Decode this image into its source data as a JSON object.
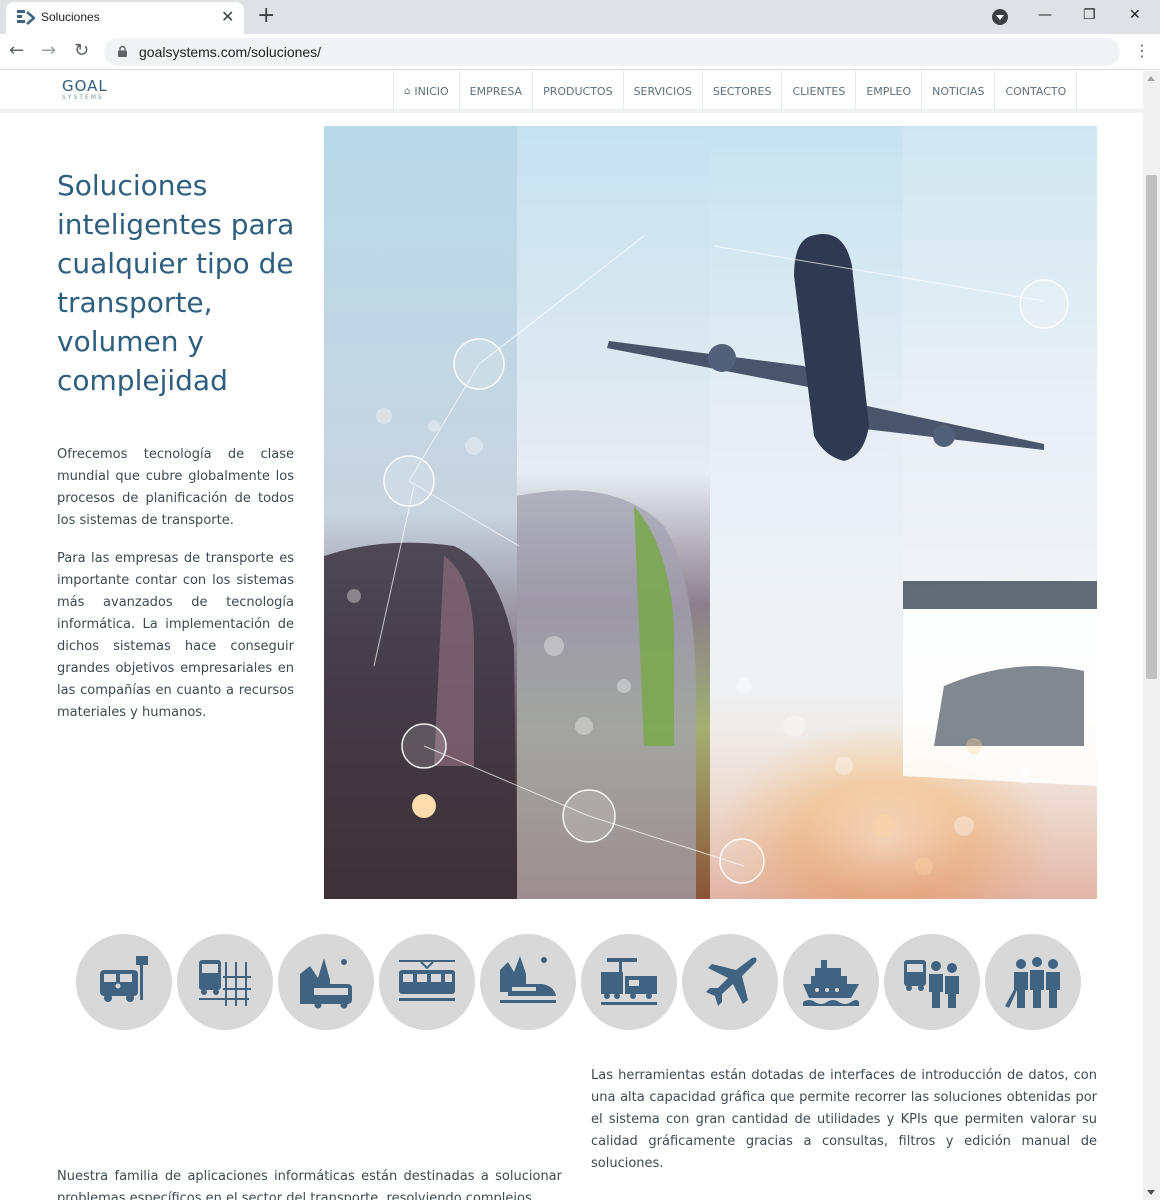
{
  "browser": {
    "tab_title": "Soluciones",
    "tab_close": "✕",
    "new_tab": "+",
    "url": "goalsystems.com/soluciones/",
    "back": "←",
    "forward": "→",
    "reload": "↻",
    "menu": "⋮",
    "minimize": "—",
    "maximize": "❐",
    "close": "✕"
  },
  "site": {
    "logo_main": "GOAL",
    "logo_sub": "SYSTEMS",
    "nav": [
      {
        "label": "INICIO",
        "icon": "home-icon"
      },
      {
        "label": "EMPRESA"
      },
      {
        "label": "PRODUCTOS"
      },
      {
        "label": "SERVICIOS"
      },
      {
        "label": "SECTORES"
      },
      {
        "label": "CLIENTES"
      },
      {
        "label": "EMPLEO"
      },
      {
        "label": "NOTICIAS"
      },
      {
        "label": "CONTACTO"
      }
    ],
    "home_glyph": "⌂"
  },
  "hero": {
    "title": "Soluciones inteligentes para cualquier tipo de transporte, volumen y complejidad",
    "paragraphs": [
      "Ofrecemos tecnología de clase mundial que cubre globalmente los procesos de planificación de todos los sistemas de transporte.",
      "Para las empresas de transporte es importante contar con los sistemas más avanzados de tecnología informática. La implementación de dichos sistemas hace conseguir grandes objetivos empresariales en las compañías en cuanto a recursos materiales y humanos."
    ]
  },
  "sectors": [
    {
      "icon": "bus-stop-icon"
    },
    {
      "icon": "bus-schedule-icon"
    },
    {
      "icon": "coach-icon"
    },
    {
      "icon": "tram-icon"
    },
    {
      "icon": "high-speed-train-icon"
    },
    {
      "icon": "freight-train-icon"
    },
    {
      "icon": "airplane-icon"
    },
    {
      "icon": "ship-icon"
    },
    {
      "icon": "crew-bus-icon"
    },
    {
      "icon": "staff-icon"
    }
  ],
  "colors": {
    "brand": "#2f5f7f",
    "icon_fill": "#3f6381",
    "circle_bg": "#d8d8d8",
    "text": "#3e4a52"
  },
  "content": {
    "right_paragraphs": [
      "Las herramientas están dotadas de interfaces de introducción de datos, con una alta capacidad gráfica que permite recorrer las soluciones obtenidas por el sistema con gran cantidad de utilidades y KPIs que permiten valorar su calidad gráficamente gracias a consultas, filtros y edición manual de soluciones."
    ],
    "left_paragraph": "Nuestra familia de aplicaciones informáticas están destinadas a solucionar problemas específicos en el sector del transporte, resolviendo complejos"
  }
}
